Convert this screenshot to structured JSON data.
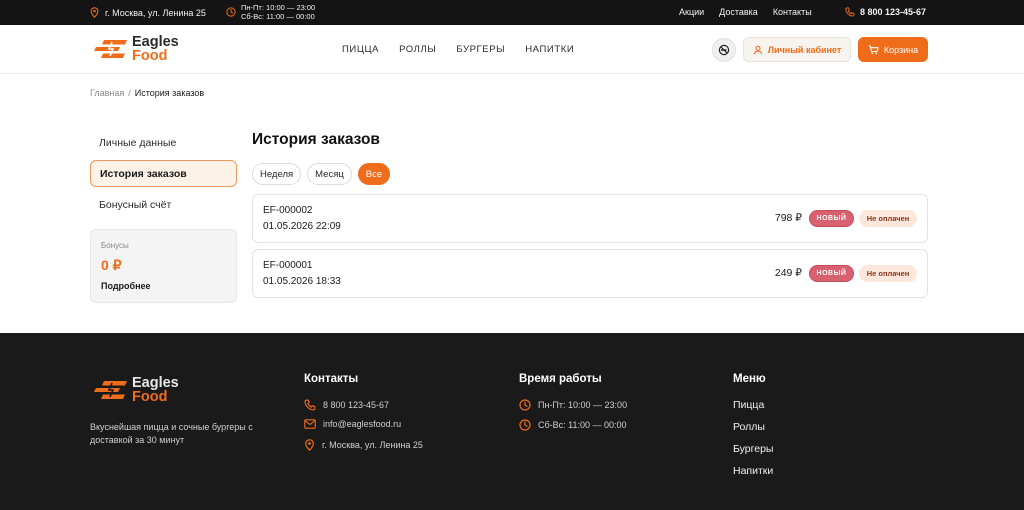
{
  "topbar": {
    "address": "г. Москва, ул. Ленина 25",
    "hours_line1": "Пн-Пт: 10:00 — 23:00",
    "hours_line2": "Сб-Вс: 11:00 — 00:00",
    "links": [
      "Акции",
      "Доставка",
      "Контакты"
    ],
    "phone": "8 800 123-45-67"
  },
  "header": {
    "logo_line1": "Eagles",
    "logo_line2": "Food",
    "nav": [
      "ПИЦЦА",
      "РОЛЛЫ",
      "БУРГЕРЫ",
      "НАПИТКИ"
    ],
    "cabinet_label": "Личный кабинет",
    "cart_label": "Корзина"
  },
  "breadcrumb": {
    "home": "Главная",
    "separator": "/",
    "current": "История заказов"
  },
  "sidebar": {
    "items": [
      {
        "label": "Личные данные",
        "active": false
      },
      {
        "label": "История заказов",
        "active": true
      },
      {
        "label": "Бонусный счёт",
        "active": false
      }
    ],
    "bonus": {
      "label": "Бонусы",
      "value": "0 ₽",
      "more": "Подробнее"
    }
  },
  "main": {
    "title": "История заказов",
    "filters": [
      {
        "label": "Неделя",
        "active": false
      },
      {
        "label": "Месяц",
        "active": false
      },
      {
        "label": "Все",
        "active": true
      }
    ],
    "orders": [
      {
        "number": "EF-000002",
        "date": "01.05.2026 22:09",
        "price": "798 ₽",
        "status": "НОВЫЙ",
        "payment": "Не оплачен"
      },
      {
        "number": "EF-000001",
        "date": "01.05.2026 18:33",
        "price": "249 ₽",
        "status": "НОВЫЙ",
        "payment": "Не оплачен"
      }
    ]
  },
  "footer": {
    "logo_line1": "Eagles",
    "logo_line2": "Food",
    "description": "Вкуснейшая пицца и сочные бургеры с доставкой за 30 минут",
    "contacts_title": "Контакты",
    "phone": "8 800 123-45-67",
    "email": "info@eaglesfood.ru",
    "address": "г. Москва, ул. Ленина 25",
    "hours_title": "Время работы",
    "hours_line1": "Пн-Пт: 10:00 — 23:00",
    "hours_line2": "Сб-Вс: 11:00 — 00:00",
    "menu_title": "Меню",
    "menu": [
      "Пицца",
      "Роллы",
      "Бургеры",
      "Напитки"
    ]
  },
  "colors": {
    "accent": "#ef6c1a",
    "dark": "#141414",
    "status_new": "#d9606e",
    "unpaid_bg": "#fbe7dc"
  },
  "icons": [
    "location-icon",
    "clock-icon",
    "phone-icon",
    "user-icon",
    "cart-icon",
    "no-smoking-icon",
    "mail-icon",
    "logo-icon"
  ]
}
